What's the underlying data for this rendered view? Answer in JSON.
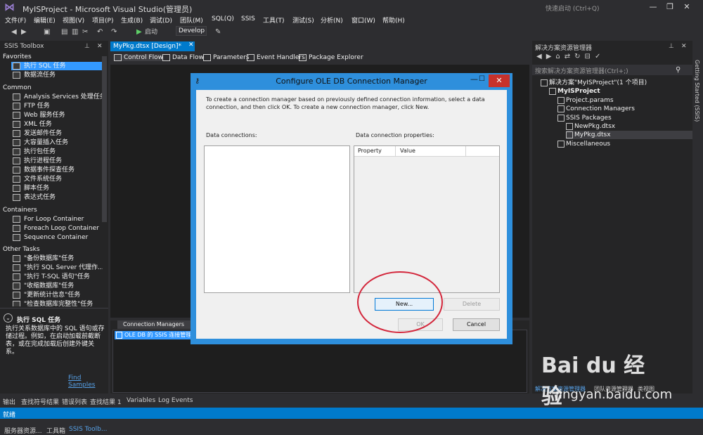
{
  "window": {
    "title": "MyISProject - Microsoft Visual Studio(管理员)",
    "quick_launch_placeholder": "快速启动 (Ctrl+Q)",
    "minimize_glyph": "—",
    "restore_glyph": "❐",
    "close_glyph": "✕"
  },
  "menu": [
    "文件(F)",
    "编辑(E)",
    "视图(V)",
    "项目(P)",
    "生成(B)",
    "调试(D)",
    "团队(M)",
    "SQL(Q)",
    "SSIS",
    "工具(T)",
    "测试(S)",
    "分析(N)",
    "窗口(W)",
    "帮助(H)"
  ],
  "toolbar": {
    "start_label": "启动",
    "config_value": "Develop"
  },
  "toolbox": {
    "title": "SSIS Toolbox",
    "categories": {
      "favorites": "Favorites",
      "common": "Common",
      "containers": "Containers",
      "other": "Other Tasks"
    },
    "favorites": [
      "执行 SQL 任务",
      "数据流任务"
    ],
    "common": [
      "Analysis Services 处理任务",
      "FTP 任务",
      "Web 服务任务",
      "XML 任务",
      "发送邮件任务",
      "大容量插入任务",
      "执行包任务",
      "执行进程任务",
      "数据事件探查任务",
      "文件系统任务",
      "脚本任务",
      "表达式任务"
    ],
    "containers": [
      "For Loop Container",
      "Foreach Loop Container",
      "Sequence Container"
    ],
    "other": [
      "\"备份数据库\"任务",
      "\"执行 SQL Server 代理作...",
      "\"执行 T-SQL 语句\"任务",
      "\"收缩数据库\"任务",
      "\"更新统计信息\"任务",
      "\"检查数据库完整性\"任务"
    ],
    "desc_title": "执行 SQL 任务",
    "desc_text": "执行关系数据库中的 SQL 语句或存储过程。例如，在启动加载前截断表，或在完成加载后创建外键关系。",
    "find_samples": "Find Samples",
    "bottom_tabs": [
      "服务器资源...",
      "工具箱",
      "SSIS Toolb..."
    ]
  },
  "designer": {
    "doc_tab": "MyPkg.dtsx [Design]*",
    "tabs": [
      "Control Flow",
      "Data Flow",
      "Parameters",
      "Event Handlers",
      "Package Explorer"
    ],
    "cm_tab": "Connection Managers",
    "cm_item": "OLE DB 的 SSIS 连接管理器"
  },
  "solution": {
    "title": "解决方案资源管理器",
    "search_placeholder": "搜索解决方案资源管理器(Ctrl+;)",
    "solution_label": "解决方案\"MyISProject\"(1 个项目)",
    "project": "MyISProject",
    "project_params": "Project.params",
    "connection_managers": "Connection Managers",
    "ssis_packages": "SSIS Packages",
    "pkg1": "NewPkg.dtsx",
    "pkg2": "MyPkg.dtsx",
    "misc": "Miscellaneous",
    "bottom_tabs": [
      "解决方案资源管理器",
      "团队资源管理器",
      "类视图"
    ],
    "side_strip": "Getting Started (SSIS)"
  },
  "output_tabs": [
    "输出",
    "查找符号结果",
    "错误列表",
    "查找结果 1",
    "Variables",
    "Log Events"
  ],
  "status": "就绪",
  "dialog": {
    "title": "Configure OLE DB Connection Manager",
    "intro": "To create a connection manager based on previously defined connection information, select a data connection, and then click OK. To create a new connection manager, click New.",
    "data_connections_label": "Data connections:",
    "properties_label": "Data connection properties:",
    "col_property": "Property",
    "col_value": "Value",
    "btn_new": "New...",
    "btn_delete": "Delete",
    "btn_ok": "OK",
    "btn_cancel": "Cancel"
  },
  "watermark": {
    "logo": "Bai du 经验",
    "url": "jingyan.baidu.com"
  }
}
